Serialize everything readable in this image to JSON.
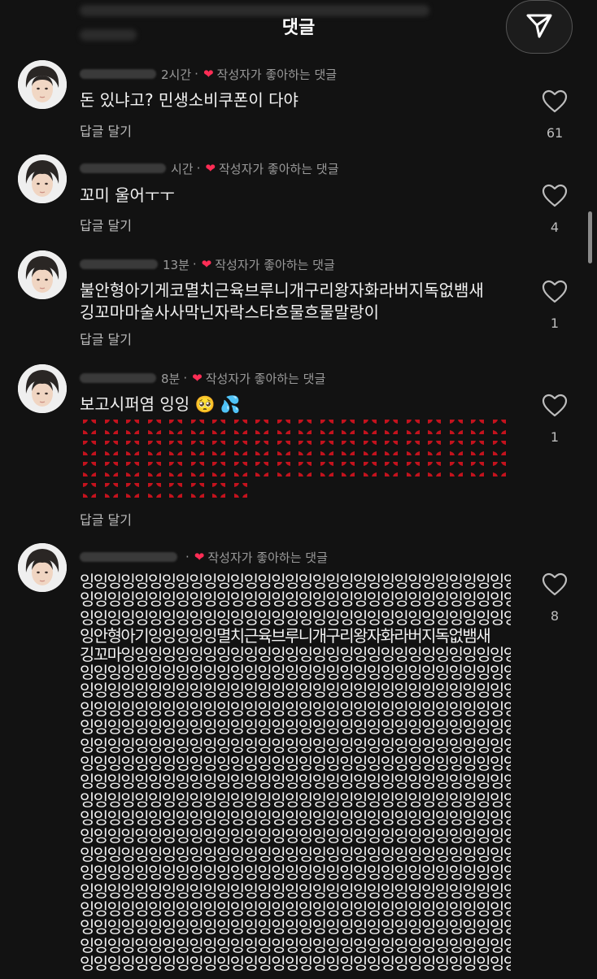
{
  "header": {
    "title": "댓글"
  },
  "comments": [
    {
      "time": "2시간",
      "dot": "·",
      "badge": "작성자가 좋아하는 댓글",
      "text": "돈 있냐고? 민생소비쿠폰이 다야",
      "reply": "답글 달기",
      "likes": "61"
    },
    {
      "time": "시간",
      "dot": "·",
      "badge": "작성자가 좋아하는 댓글",
      "text": "꼬미 울어ㅜㅜ",
      "reply": "답글 달기",
      "likes": "4"
    },
    {
      "time": "13분",
      "dot": "·",
      "badge": "작성자가 좋아하는 댓글",
      "text_line1": "불안형아기게코멸치근육브루니개구리왕자화라버지독없뱀새",
      "text_line2": "깅꼬마마술사사막닌자락스타흐물흐물말랑이",
      "reply": "답글 달기",
      "likes": "1"
    },
    {
      "time": "8분",
      "dot": "·",
      "badge": "작성자가 좋아하는 댓글",
      "text": "보고시퍼염 잉잉 🥺 💦",
      "anger_rows": [
        20,
        20,
        20,
        8
      ],
      "reply": "답글 달기",
      "likes": "1"
    },
    {
      "time": "",
      "dot": "·",
      "badge": "작성자가 좋아하는 댓글",
      "lines": [
        "잉잉잉잉잉잉잉잉잉잉잉잉잉잉잉잉잉잉잉잉잉잉잉잉잉잉잉잉잉잉잉잉잉잉잉잉잉잉잉잉잉잉잉잉잉",
        "잉잉잉잉잉잉잉잉잉잉잉잉잉잉잉잉잉잉잉잉잉잉잉잉잉잉잉잉잉잉잉잉잉잉잉잉잉잉잉잉잉잉잉잉잉",
        "잉잉잉잉잉잉잉잉잉잉잉잉잉잉잉잉잉잉잉잉잉잉잉잉잉잉잉잉잉잉잉잉잉잉잉잉잉잉잉잉잉잉잉잉잉",
        "잉안형아기잉잉잉잉잉멸치근육브루니개구리왕자화라버지독없뱀새",
        "깅꼬마잉잉잉잉잉잉잉잉잉잉잉잉잉잉잉잉잉잉잉잉잉잉잉잉잉잉잉잉잉잉잉잉잉잉잉잉잉잉잉잉",
        "잉잉잉잉잉잉잉잉잉잉잉잉잉잉잉잉잉잉잉잉잉잉잉잉잉잉잉잉잉잉잉잉잉잉잉잉잉잉잉잉잉잉잉잉잉",
        "잉잉잉잉잉잉잉잉잉잉잉잉잉잉잉잉잉잉잉잉잉잉잉잉잉잉잉잉잉잉잉잉잉잉잉잉잉잉잉잉잉잉잉잉잉",
        "잉잉잉잉잉잉잉잉잉잉잉잉잉잉잉잉잉잉잉잉잉잉잉잉잉잉잉잉잉잉잉잉잉잉잉잉잉잉잉잉잉잉잉잉잉",
        "잉잉잉잉잉잉잉잉잉잉잉잉잉잉잉잉잉잉잉잉잉잉잉잉잉잉잉잉잉잉잉잉잉잉잉잉잉잉잉잉잉잉잉잉잉",
        "잉잉잉잉잉잉잉잉잉잉잉잉잉잉잉잉잉잉잉잉잉잉잉잉잉잉잉잉잉잉잉잉잉잉잉잉잉잉잉잉잉잉잉잉잉",
        "잉잉잉잉잉잉잉잉잉잉잉잉잉잉잉잉잉잉잉잉잉잉잉잉잉잉잉잉잉잉잉잉잉잉잉잉잉잉잉잉잉잉잉잉잉",
        "잉잉잉잉잉잉잉잉잉잉잉잉잉잉잉잉잉잉잉잉잉잉잉잉잉잉잉잉잉잉잉잉잉잉잉잉잉잉잉잉잉잉잉잉잉",
        "잉잉잉잉잉잉잉잉잉잉잉잉잉잉잉잉잉잉잉잉잉잉잉잉잉잉잉잉잉잉잉잉잉잉잉잉잉잉잉잉잉잉잉잉잉",
        "잉잉잉잉잉잉잉잉잉잉잉잉잉잉잉잉잉잉잉잉잉잉잉잉잉잉잉잉잉잉잉잉잉잉잉잉잉잉잉잉잉잉잉잉잉",
        "잉잉잉잉잉잉잉잉잉잉잉잉잉잉잉잉잉잉잉잉잉잉잉잉잉잉잉잉잉잉잉잉잉잉잉잉잉잉잉잉잉잉잉잉잉",
        "잉잉잉잉잉잉잉잉잉잉잉잉잉잉잉잉잉잉잉잉잉잉잉잉잉잉잉잉잉잉잉잉잉잉잉잉잉잉잉잉잉잉잉잉잉",
        "잉잉잉잉잉잉잉잉잉잉잉잉잉잉잉잉잉잉잉잉잉잉잉잉잉잉잉잉잉잉잉잉잉잉잉잉잉잉잉잉잉잉잉잉잉",
        "잉잉잉잉잉잉잉잉잉잉잉잉잉잉잉잉잉잉잉잉잉잉잉잉잉잉잉잉잉잉잉잉잉잉잉잉잉잉잉잉잉잉잉잉잉",
        "잉잉잉잉잉잉잉잉잉잉잉잉잉잉잉잉잉잉잉잉잉잉잉잉잉잉잉잉잉잉잉잉잉잉잉잉잉잉잉잉잉잉잉잉잉",
        "잉잉잉잉잉잉잉잉잉잉잉잉잉잉잉잉잉잉잉잉잉잉잉잉잉잉잉잉잉잉잉잉잉잉잉잉잉잉잉잉잉잉잉잉잉",
        "잉잉잉잉잉잉잉잉잉잉잉잉잉잉잉잉잉잉잉잉잉잉잉잉잉잉잉잉잉잉잉잉잉잉잉잉잉잉잉잉잉잉잉잉잉",
        "잉잉잉잉잉잉잉잉잉잉잉잉잉잉잉잉잉잉잉잉잉잉잉잉잉잉잉잉잉잉잉잉잉잉잉잉잉잉잉잉잉잉잉잉잉"
      ],
      "likes": "8"
    }
  ],
  "colors": {
    "heart_badge": "#ff2d55",
    "anger": "#c4121d",
    "background": "#121212"
  },
  "icons": {
    "send": "send-paper-plane-icon",
    "like": "heart-outline-icon",
    "anger": "anger-symbol-icon"
  }
}
